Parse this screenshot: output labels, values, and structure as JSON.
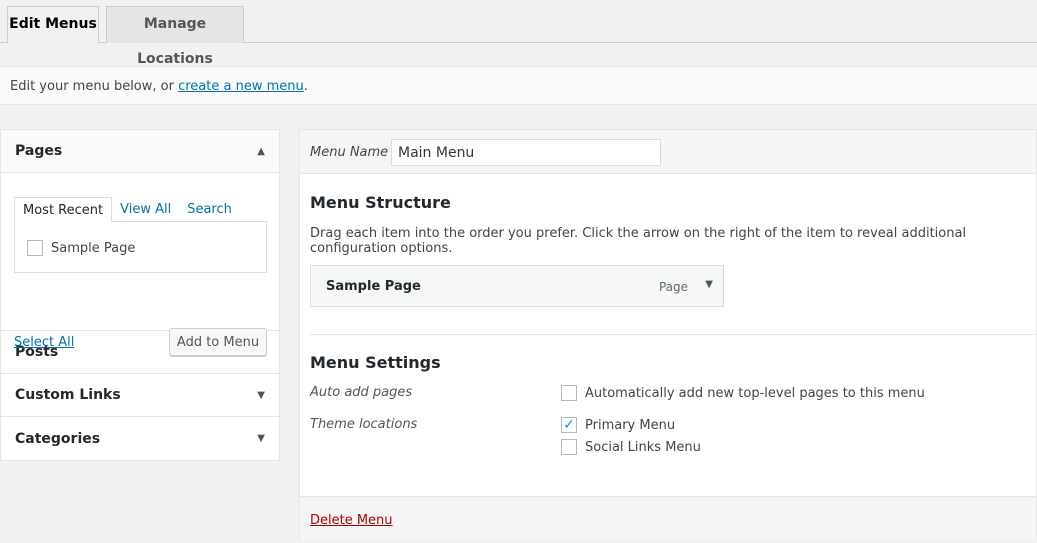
{
  "tabs": [
    {
      "label": "Edit Menus",
      "active": true
    },
    {
      "label": "Manage Locations",
      "active": false
    }
  ],
  "notice": {
    "text": "Edit your menu below, or ",
    "link": "create a new menu",
    "suffix": "."
  },
  "sidebar": {
    "sections": [
      {
        "title": "Pages",
        "expanded": true
      },
      {
        "title": "Posts",
        "expanded": false
      },
      {
        "title": "Custom Links",
        "expanded": false
      },
      {
        "title": "Categories",
        "expanded": false
      }
    ],
    "pages": {
      "tabs": [
        "Most Recent",
        "View All",
        "Search"
      ],
      "items": [
        {
          "label": "Sample Page",
          "checked": false
        }
      ],
      "select_all": "Select All",
      "add_button": "Add to Menu"
    }
  },
  "editor": {
    "menu_name_label": "Menu Name",
    "menu_name_value": "Main Menu",
    "structure_title": "Menu Structure",
    "structure_desc": "Drag each item into the order you prefer. Click the arrow on the right of the item to reveal additional configuration options.",
    "items": [
      {
        "title": "Sample Page",
        "type": "Page"
      }
    ],
    "settings_title": "Menu Settings",
    "auto_add_label": "Auto add pages",
    "auto_add_option": "Automatically add new top-level pages to this menu",
    "auto_add_checked": false,
    "theme_locations_label": "Theme locations",
    "locations": [
      {
        "label": "Primary Menu",
        "checked": true
      },
      {
        "label": "Social Links Menu",
        "checked": false
      }
    ],
    "delete_link": "Delete Menu"
  },
  "icons": {
    "expanded_arrow": "▲",
    "collapsed_arrow": "▼",
    "check": "✓"
  },
  "colors": {
    "link": "#0073aa",
    "delete": "#a00000",
    "check": "#1e8cbe"
  }
}
